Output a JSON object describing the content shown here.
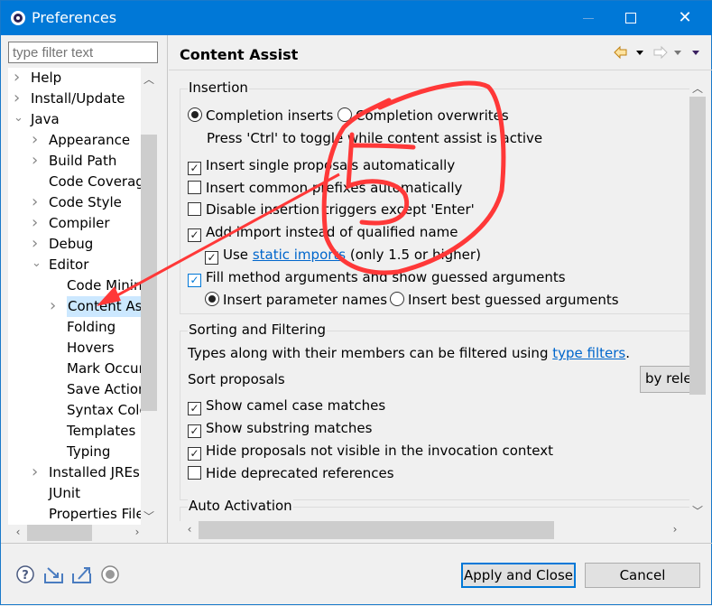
{
  "window": {
    "title": "Preferences",
    "accent": "#0078d7"
  },
  "filter": {
    "placeholder": "type filter text"
  },
  "tree": [
    {
      "label": "Help",
      "expander": "collapsed",
      "level": 0
    },
    {
      "label": "Install/Update",
      "expander": "collapsed",
      "level": 0
    },
    {
      "label": "Java",
      "expander": "expanded",
      "level": 0
    },
    {
      "label": "Appearance",
      "expander": "collapsed",
      "level": 1
    },
    {
      "label": "Build Path",
      "expander": "collapsed",
      "level": 1
    },
    {
      "label": "Code Coverage",
      "expander": "none",
      "level": 1
    },
    {
      "label": "Code Style",
      "expander": "collapsed",
      "level": 1
    },
    {
      "label": "Compiler",
      "expander": "collapsed",
      "level": 1
    },
    {
      "label": "Debug",
      "expander": "collapsed",
      "level": 1
    },
    {
      "label": "Editor",
      "expander": "expanded",
      "level": 1
    },
    {
      "label": "Code Minings",
      "expander": "none",
      "level": 2
    },
    {
      "label": "Content Assist",
      "expander": "collapsed",
      "level": 2,
      "selected": true
    },
    {
      "label": "Folding",
      "expander": "none",
      "level": 2
    },
    {
      "label": "Hovers",
      "expander": "none",
      "level": 2
    },
    {
      "label": "Mark Occurrences",
      "expander": "none",
      "level": 2
    },
    {
      "label": "Save Actions",
      "expander": "none",
      "level": 2
    },
    {
      "label": "Syntax Coloring",
      "expander": "none",
      "level": 2
    },
    {
      "label": "Templates",
      "expander": "none",
      "level": 2
    },
    {
      "label": "Typing",
      "expander": "none",
      "level": 2
    },
    {
      "label": "Installed JREs",
      "expander": "collapsed",
      "level": 1
    },
    {
      "label": "JUnit",
      "expander": "none",
      "level": 1
    },
    {
      "label": "Properties Files Editor",
      "expander": "none",
      "level": 1
    }
  ],
  "page": {
    "title": "Content Assist"
  },
  "insertion": {
    "title": "Insertion",
    "completion_inserts": "Completion inserts",
    "completion_overwrites": "Completion overwrites",
    "hint": "Press 'Ctrl' to toggle while content assist is active",
    "insert_single": "Insert single proposals automatically",
    "insert_common": "Insert common prefixes automatically",
    "disable_triggers": "Disable insertion triggers except 'Enter'",
    "add_import": "Add import instead of qualified name",
    "use_prefix": "Use",
    "static_imports": "static imports",
    "use_suffix": "(only 1.5 or higher)",
    "fill_args": "Fill method arguments and show guessed arguments",
    "insert_param_names": "Insert parameter names",
    "insert_best_guessed": "Insert best guessed arguments"
  },
  "sorting": {
    "title": "Sorting and Filtering",
    "text": "Types along with their members can be filtered using",
    "link": "type filters",
    "period": ".",
    "sort_label": "Sort proposals",
    "sort_value": "by relevance",
    "camel": "Show camel case matches",
    "substring": "Show substring matches",
    "hide_invisible": "Hide proposals not visible in the invocation context",
    "hide_deprecated": "Hide deprecated references"
  },
  "auto_activation": {
    "title": "Auto Activation"
  },
  "buttons": {
    "apply_close": "Apply and Close",
    "cancel": "Cancel"
  },
  "annotation": {
    "number": "5",
    "color": "#ff3030"
  }
}
